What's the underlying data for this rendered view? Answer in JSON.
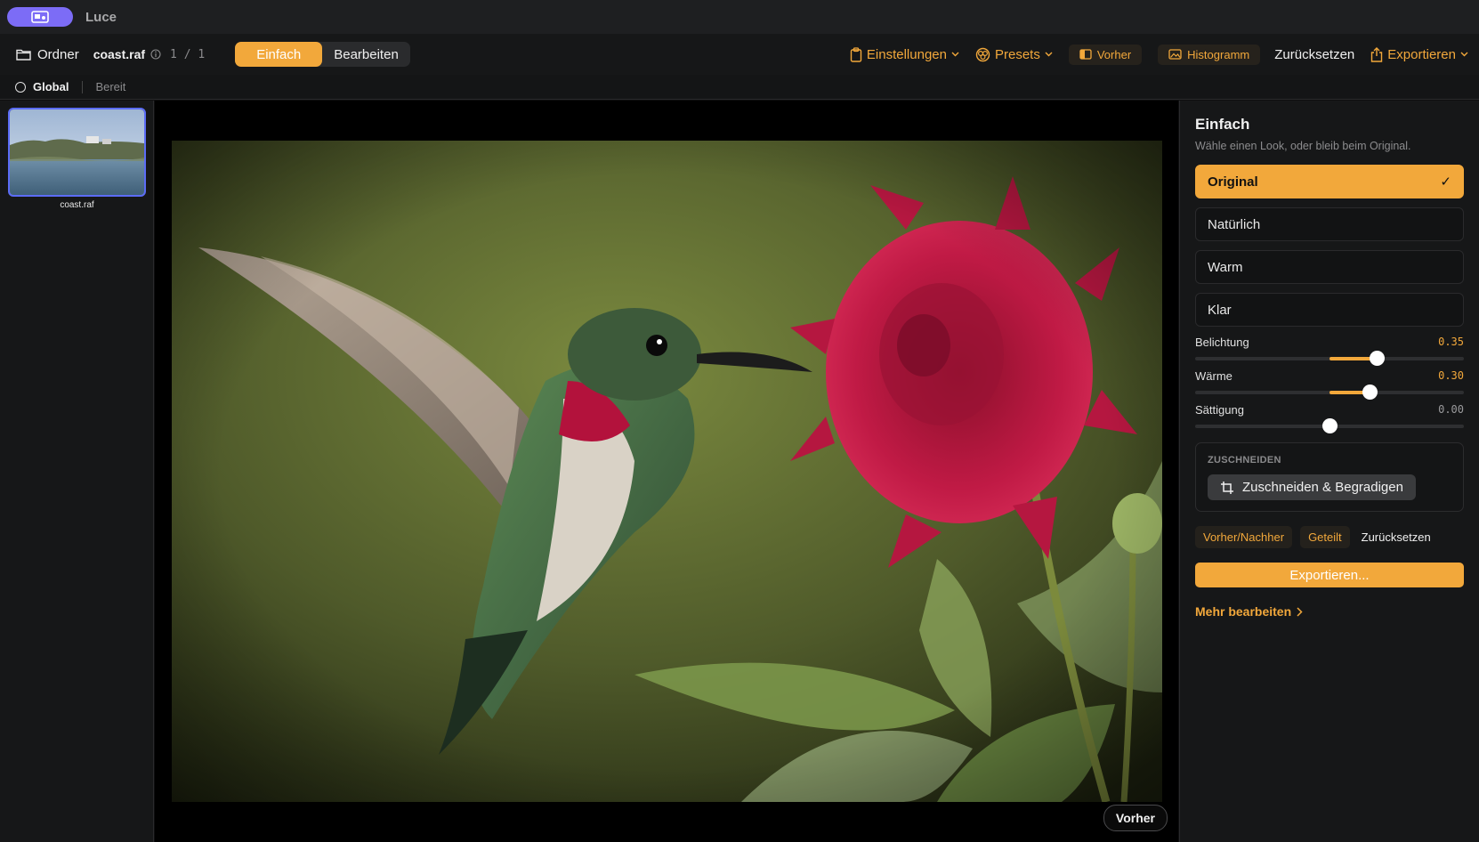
{
  "app": {
    "title": "Luce"
  },
  "toolbar": {
    "folder_label": "Ordner",
    "filename": "coast.raf",
    "counter": "1 / 1",
    "modes": [
      "Einfach",
      "Bearbeiten"
    ],
    "active_mode": "Einfach",
    "settings_label": "Einstellungen",
    "presets_label": "Presets",
    "before_label": "Vorher",
    "histogram_label": "Histogramm",
    "reset_label": "Zurücksetzen",
    "export_label": "Exportieren"
  },
  "subbar": {
    "scope": "Global",
    "status": "Bereit"
  },
  "filmstrip": {
    "items": [
      {
        "label": "coast.raf"
      }
    ]
  },
  "canvas": {
    "badge": "Vorher"
  },
  "panel": {
    "title": "Einfach",
    "subtitle": "Wähle einen Look, oder bleib beim Original.",
    "looks": [
      {
        "label": "Original",
        "selected": true
      },
      {
        "label": "Natürlich",
        "selected": false
      },
      {
        "label": "Warm",
        "selected": false
      },
      {
        "label": "Klar",
        "selected": false
      }
    ],
    "sliders": [
      {
        "label": "Belichtung",
        "value_text": "0.35",
        "value": 0.35
      },
      {
        "label": "Wärme",
        "value_text": "0.30",
        "value": 0.3
      },
      {
        "label": "Sättigung",
        "value_text": "0.00",
        "value": 0.0
      }
    ],
    "crop": {
      "section_label": "ZUSCHNEIDEN",
      "button_label": "Zuschneiden & Begradigen"
    },
    "actions": {
      "before_after": "Vorher/Nachher",
      "split": "Geteilt",
      "reset": "Zurücksetzen"
    },
    "export_button": "Exportieren...",
    "more_link": "Mehr bearbeiten"
  },
  "colors": {
    "accent": "#f2a83b",
    "app_pill": "#7c6cf6",
    "selection": "#5b6cf6"
  }
}
